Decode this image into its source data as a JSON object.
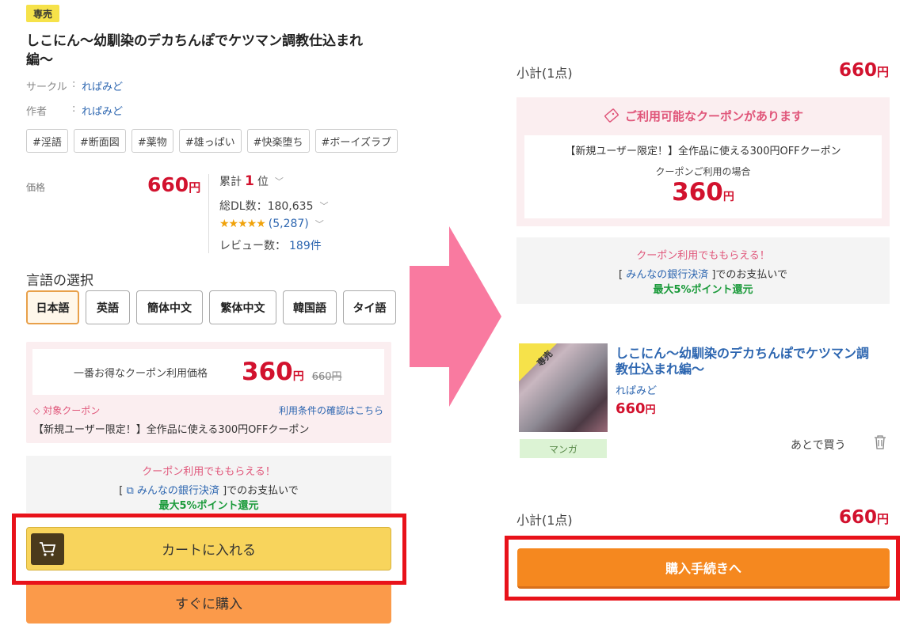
{
  "left": {
    "badge": "専売",
    "title": "しこにん〜幼馴染のデカちんぽでケツマン調教仕込まれ編〜",
    "circle_label": "サークル",
    "circle_value": "れぱみど",
    "author_label": "作者",
    "author_value": "れぱみど",
    "colon": ":",
    "tags": [
      "#淫語",
      "#断面図",
      "#薬物",
      "#雄っぱい",
      "#快楽堕ち",
      "#ボーイズラブ"
    ],
    "price_label": "価格",
    "price": "660",
    "yen": "円",
    "rank_label": "累計",
    "rank_num": "1",
    "rank_suffix": "位",
    "dl_text": "総DL数：180,635",
    "stars": "★★★★★",
    "rating_count": "(5,287)",
    "review_label": "レビュー数：",
    "review_count": "189件",
    "lang_title": "言語の選択",
    "languages": [
      "日本語",
      "英語",
      "簡体中文",
      "繁体中文",
      "韓国語",
      "タイ語"
    ],
    "coupon_best_label": "一番お得なクーポン利用価格",
    "coupon_price": "360",
    "coupon_strike": "660円",
    "coupon_target": "対象クーポン",
    "coupon_terms": "利用条件の確認はこちら",
    "coupon_desc": "【新規ユーザー限定！】全作品に使える300円OFFクーポン",
    "points_line1": "クーポン利用でももらえる！",
    "points_bank": "みんなの銀行決済",
    "points_line2_suffix": "]でのお支払いで",
    "points_line3": "最大5%ポイント還元",
    "cart_button": "カートに入れる",
    "buy_button": "すぐに購入"
  },
  "right": {
    "subtotal_label": "小計(1点)",
    "subtotal_price": "660",
    "yen": "円",
    "coupon_available": "ご利用可能なクーポンがあります",
    "coupon_desc": "【新規ユーザー限定！】全作品に使える300円OFFクーポン",
    "coupon_case": "クーポンご利用の場合",
    "coupon_price": "360",
    "points_line1": "クーポン利用でももらえる！",
    "points_bank": "みんなの銀行決済",
    "points_line2_suffix": "]でのお支払いで",
    "points_line3": "最大5%ポイント還元",
    "item_badge": "専売",
    "item_title": "しこにん〜幼馴染のデカちんぽでケツマン調教仕込まれ編〜",
    "item_circle": "れぱみど",
    "item_price": "660",
    "item_category": "マンガ",
    "later": "あとで買う",
    "proceed_button": "購入手続きへ"
  },
  "colors": {
    "price_red": "#d2122e",
    "highlight_frame": "#e8121a",
    "arrow_pink": "#f97aa0",
    "proceed_orange": "#f5881f",
    "cart_yellow": "#f8d45c"
  }
}
